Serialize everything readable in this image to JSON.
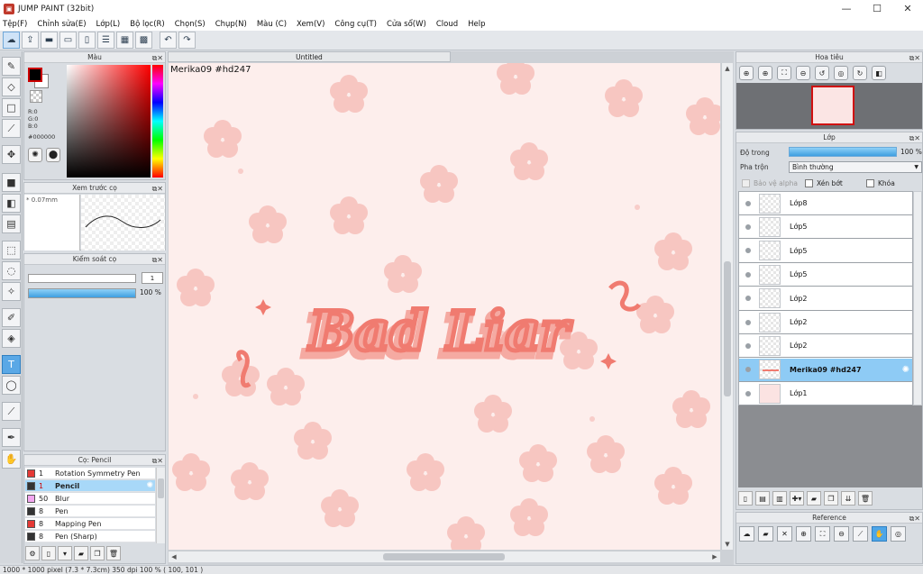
{
  "window": {
    "title": "JUMP PAINT (32bit)",
    "minimize": "—",
    "maximize": "☐",
    "close": "✕"
  },
  "menu": [
    "Tệp(F)",
    "Chỉnh sửa(E)",
    "Lớp(L)",
    "Bộ lọc(R)",
    "Chọn(S)",
    "Chụp(N)",
    "Màu (C)",
    "Xem(V)",
    "Công cụ(T)",
    "Cửa sổ(W)",
    "Cloud",
    "Help"
  ],
  "color_panel": {
    "title": "Màu",
    "r": "R:0",
    "g": "G:0",
    "b": "B:0",
    "hex": "#000000",
    "fg": "#000000",
    "bg": "#ffffff"
  },
  "brush_preview": {
    "title": "Xem trước cọ",
    "size_label": "* 0.07mm"
  },
  "brush_control": {
    "title": "Kiểm soát cọ",
    "size_value": "1",
    "opacity_value": "100 %",
    "opacity_fraction": 1.0
  },
  "brush_list": {
    "title": "Cọ: Pencil",
    "items": [
      {
        "num": "1",
        "name": "Rotation Symmetry Pen",
        "color": "#e53935",
        "active": false
      },
      {
        "num": "1",
        "name": "Pencil",
        "color": "#333333",
        "active": true
      },
      {
        "num": "50",
        "name": "Blur",
        "color": "#f3a6f0",
        "active": false
      },
      {
        "num": "8",
        "name": "Pen",
        "color": "#333333",
        "active": false
      },
      {
        "num": "8",
        "name": "Mapping Pen",
        "color": "#e53935",
        "active": false
      },
      {
        "num": "8",
        "name": "Pen (Sharp)",
        "color": "#333333",
        "active": false
      }
    ]
  },
  "document": {
    "tab": "Untitled",
    "caption": "Merika09  #hd247",
    "artwork_text": "Bad Liar"
  },
  "navigator": {
    "title": "Hoa tiêu"
  },
  "layers": {
    "title": "Lớp",
    "opacity_label": "Độ trong",
    "opacity_value": "100 %",
    "opacity_fraction": 1.0,
    "blend_label": "Pha trộn",
    "blend_value": "Bình thường",
    "protect_alpha": "Bảo vệ alpha",
    "clipping": "Xén bớt",
    "lock": "Khóa",
    "items": [
      {
        "name": "Lớp8",
        "active": false,
        "thumb": "empty"
      },
      {
        "name": "Lớp5",
        "active": false,
        "thumb": "empty"
      },
      {
        "name": "Lớp5",
        "active": false,
        "thumb": "empty"
      },
      {
        "name": "Lớp5",
        "active": false,
        "thumb": "empty"
      },
      {
        "name": "Lớp2",
        "active": false,
        "thumb": "empty"
      },
      {
        "name": "Lớp2",
        "active": false,
        "thumb": "empty"
      },
      {
        "name": "Lớp2",
        "active": false,
        "thumb": "empty"
      },
      {
        "name": "Merika09  #hd247",
        "active": true,
        "thumb": "text"
      },
      {
        "name": "Lớp1",
        "active": false,
        "thumb": "pink"
      }
    ]
  },
  "reference": {
    "title": "Reference"
  },
  "status": {
    "text": "1000 * 1000 pixel  (7.3 * 7.3cm)  350 dpi  100 %  ( 100, 101 )"
  },
  "colors": {
    "accent": "#5aa8e6",
    "canvas_bg": "#fdeeec",
    "flower": "#f5b8b3",
    "lettering": "#f07b70"
  }
}
